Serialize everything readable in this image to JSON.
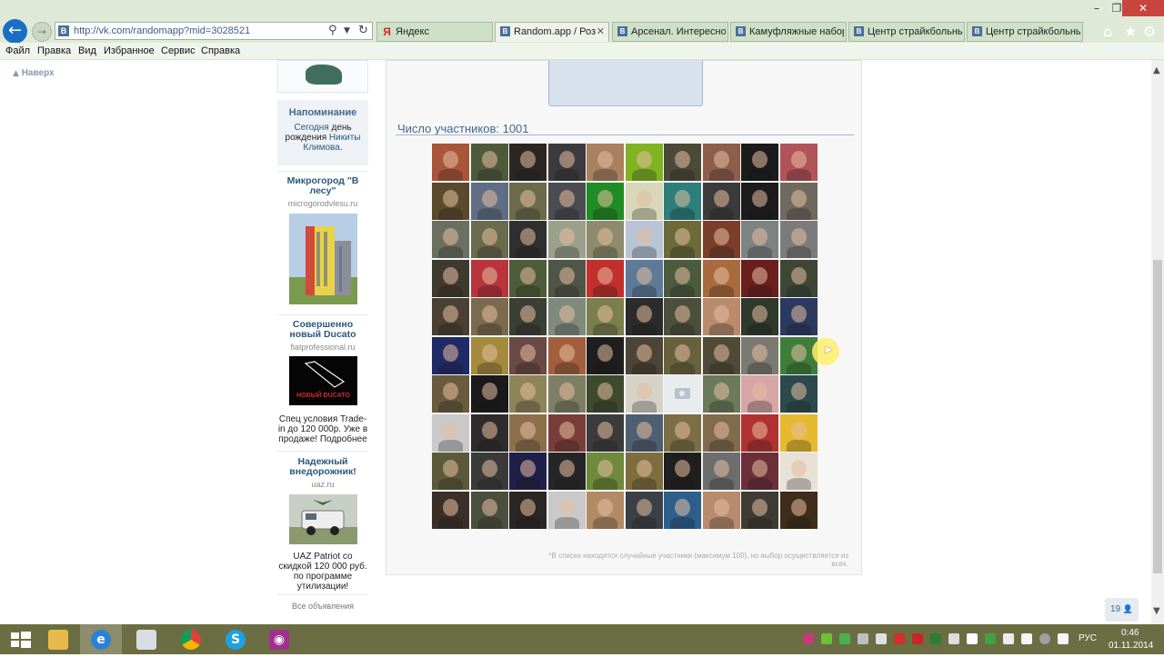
{
  "browser": {
    "url": "http://vk.com/randomapp?mid=3028521",
    "tabs": [
      {
        "label": "Яндекс",
        "favicon": "yandex-icon",
        "active": false
      },
      {
        "label": "Random.app / Роз...",
        "favicon": "vk-icon",
        "active": true
      },
      {
        "label": "Арсенал. Интересно ...",
        "favicon": "vk-icon",
        "active": false
      },
      {
        "label": "Камуфляжные набор...",
        "favicon": "vk-icon",
        "active": false
      },
      {
        "label": "Центр страйкбольны...",
        "favicon": "vk-icon",
        "active": false
      },
      {
        "label": "Центр страйкбольны...",
        "favicon": "vk-icon",
        "active": false
      }
    ],
    "menu": [
      "Файл",
      "Правка",
      "Вид",
      "Избранное",
      "Сервис",
      "Справка"
    ]
  },
  "page": {
    "scroll_up": "Наверх",
    "reminder": {
      "title": "Напоминание",
      "today": "Сегодня",
      "middle": " день рождения ",
      "name": "Никиты Климова",
      "end": "."
    },
    "ads": [
      {
        "title": "Микрогород \"В лесу\"",
        "domain": "microgorodvlesu.ru",
        "text": ""
      },
      {
        "title": "Совершенно новый Ducato",
        "domain": "fiatprofessional.ru",
        "image_caption": "НОВЫЙ DUCATO",
        "text": "Спец условия Trade-in до 120 000р. Уже в продаже! Подробнее"
      },
      {
        "title": "Надежный внедорожник!",
        "domain": "uaz.ru",
        "text": "UAZ Patriot со скидкой 120 000 руб. по программе утилизации!"
      }
    ],
    "all_ads": "Все объявления",
    "participants_title": "Число участников: 1001",
    "footnote": "*В списке находятся случайные участники (максимум 100), но выбор осуществляется из всех.",
    "side_counter": "19",
    "avatar_colors": [
      "#a8553a",
      "#4f5a3a",
      "#2b2622",
      "#3b3b3f",
      "#a9815f",
      "#7fb321",
      "#4b4937",
      "#8e5e4b",
      "#1b1b1b",
      "#b2535a",
      "#5b4a2b",
      "#5f6e85",
      "#6b6b4a",
      "#4a4c52",
      "#1f8c25",
      "#d8d8b8",
      "#2c7f7a",
      "#3b3b3b",
      "#1c1c1c",
      "#6f6a60",
      "#6b6f60",
      "#6a6a4c",
      "#2f2f2f",
      "#9aa08a",
      "#8e8a6d",
      "#b8c4d6",
      "#6b6a38",
      "#7a3e2a",
      "#7d8380",
      "#7b7b7b",
      "#3f3a2f",
      "#b9343c",
      "#4e5c3a",
      "#4f5547",
      "#c2302c",
      "#5e7a98",
      "#4c5a3d",
      "#a96a3e",
      "#6b1e1e",
      "#3e4636",
      "#4a4034",
      "#7a6a4e",
      "#3a3f33",
      "#7f8a7d",
      "#7a7f4d",
      "#2b2b2b",
      "#4b4f3c",
      "#b98b6a",
      "#2f3a2c",
      "#2c3a60",
      "#1f2b66",
      "#a58a3e",
      "#6a4a44",
      "#a35f3d",
      "#1e1e1e",
      "#4c4436",
      "#68613d",
      "#4f4a37",
      "#7a7a72",
      "#3f7e3a",
      "#6a5a3e",
      "#1a1a1a",
      "#8e8458",
      "#7d7f64",
      "#3e4a2e",
      "#d6d2c6",
      "#e9ecef",
      "#6b7a5b",
      "#d6a5a5",
      "#2c4a4e",
      "#c9c9c9",
      "#2e2b2c",
      "#8d6f4a",
      "#7b3d3a",
      "#3b3b3b",
      "#4f5f72",
      "#7d6f45",
      "#826a4c",
      "#b03230",
      "#e6b930",
      "#5a5a3a",
      "#3a3a3a",
      "#1f1f4a",
      "#262629",
      "#6e8a3a",
      "#7e6e3e",
      "#1f1f1f",
      "#6d6d6d",
      "#6b2f3a",
      "#e8e1d6",
      "#3b2f28",
      "#4d4f3e",
      "#2a2623",
      "#c9c9c9",
      "#b38a66",
      "#3b3f46",
      "#2c5f8c",
      "#b88a6e",
      "#3f3b33",
      "#3d2d1a"
    ]
  }
}
